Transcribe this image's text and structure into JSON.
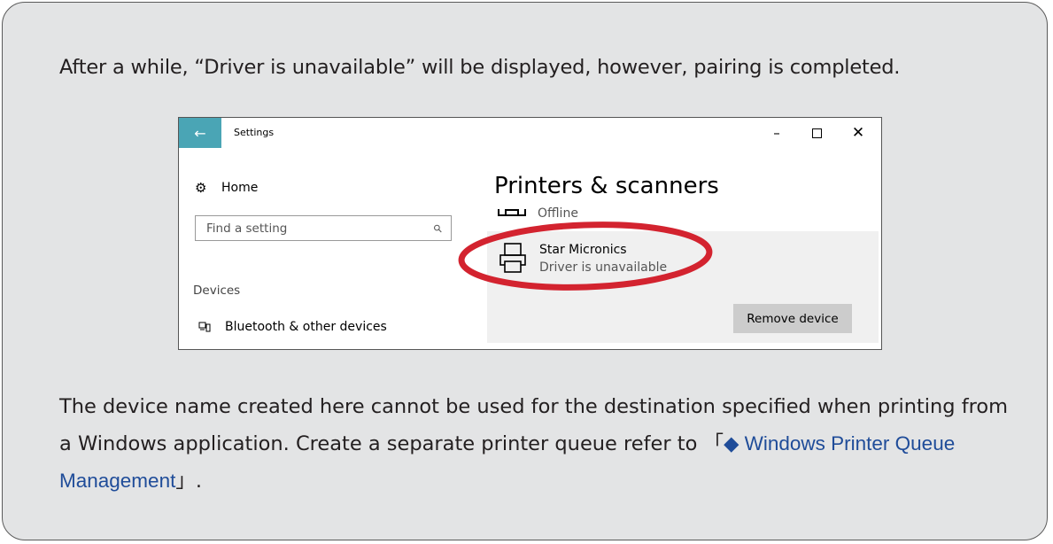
{
  "instructions": {
    "intro": "After a while, “Driver is unavailable” will be displayed, however, pairing is completed.",
    "note_before_link": "The device name created here cannot be used for the destination specified when printing from a Windows application. Create a separate printer queue refer to 「",
    "link_label": "◆ Windows Printer Queue Management",
    "note_after_link": "」."
  },
  "window": {
    "title": "Settings",
    "back_icon": "←",
    "minimize_icon": "–",
    "close_icon": "✕",
    "accent_color": "#4aa5b5"
  },
  "sidebar": {
    "home_label": "Home",
    "search_placeholder": "Find a setting",
    "devices_heading": "Devices",
    "bluetooth_label": "Bluetooth & other devices"
  },
  "main": {
    "title": "Printers & scanners",
    "offline_status": "Offline",
    "device_name": "Star Micronics",
    "device_status": "Driver is unavailable",
    "remove_button": "Remove device",
    "highlight_color": "#d3232f"
  }
}
